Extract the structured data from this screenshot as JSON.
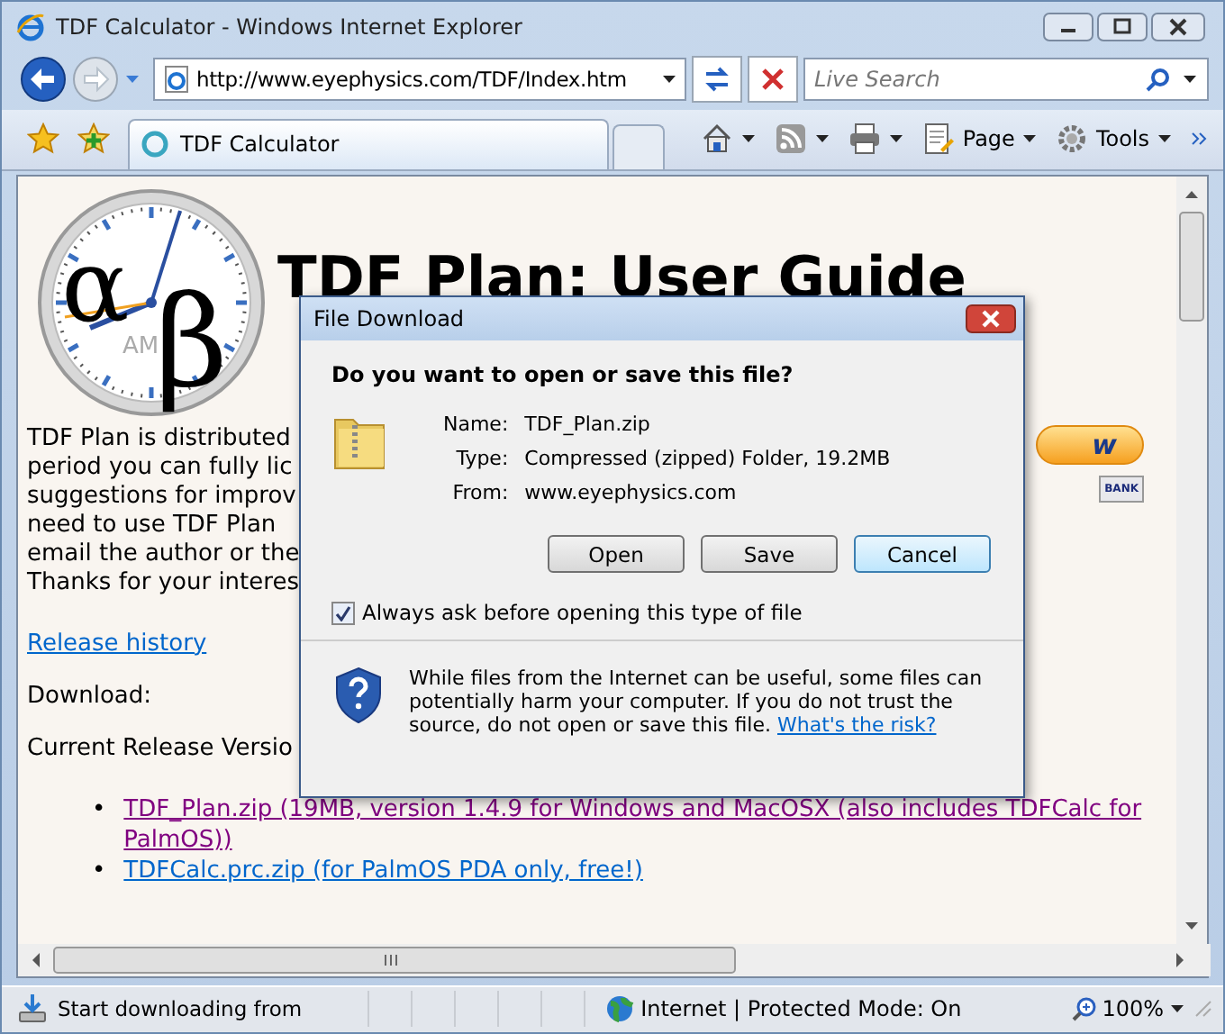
{
  "window": {
    "title": "TDF Calculator - Windows Internet Explorer"
  },
  "address_bar": {
    "url": "http://www.eyephysics.com/TDF/Index.htm"
  },
  "search": {
    "placeholder": "Live Search"
  },
  "tabs": [
    {
      "label": "TDF Calculator",
      "selected": true
    }
  ],
  "command_bar": [
    {
      "kind": "home"
    },
    {
      "kind": "feeds"
    },
    {
      "kind": "print"
    },
    {
      "kind": "page",
      "label": "Page"
    },
    {
      "kind": "tools",
      "label": "Tools"
    }
  ],
  "page": {
    "logo": {
      "alpha": "α",
      "beta": "β",
      "am": "AM"
    },
    "heading": "TDF Plan: User Guide",
    "intro_lines": [
      "TDF Plan is distributed",
      "period you can fully lic",
      "suggestions for improv",
      "need to use TDF Plan",
      "email the author or the",
      "Thanks for your interes"
    ],
    "buy_button": "w",
    "payment_badge": "BANK",
    "release_link": "Release history",
    "download_label": "Download:",
    "current_label": "Current Release Versio",
    "downloads": [
      {
        "bullet": "•",
        "text": "TDF_Plan.zip (19MB, version 1.4.9 for Windows and MacOSX (also includes TDFCalc for PalmOS))",
        "visited": true
      },
      {
        "bullet": "•",
        "text": "TDFCalc.prc.zip (for PalmOS PDA only, free!)",
        "visited": false
      }
    ]
  },
  "dialog": {
    "title": "File Download",
    "question": "Do you want to open or save this file?",
    "fields": [
      {
        "label": "Name:",
        "value": "TDF_Plan.zip"
      },
      {
        "label": "Type:",
        "value": "Compressed (zipped) Folder, 19.2MB"
      },
      {
        "label": "From:",
        "value": "www.eyephysics.com"
      }
    ],
    "buttons": [
      {
        "label": "Open",
        "default": false
      },
      {
        "label": "Save",
        "default": false
      },
      {
        "label": "Cancel",
        "default": true
      }
    ],
    "always_ask": {
      "label": "Always ask before opening this type of file",
      "checked": true
    },
    "warning": "While files from the Internet can be useful, some files can potentially harm your computer. If you do not trust the source, do not open or save this file.",
    "risk_link": "What's the risk?"
  },
  "status_bar": {
    "text": "Start downloading from",
    "zone": "Internet | Protected Mode: On",
    "zoom": "100%"
  }
}
